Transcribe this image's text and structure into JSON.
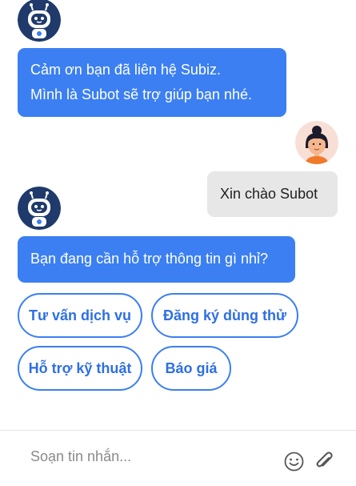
{
  "messages": {
    "bot_greeting_line1": "Cảm ơn bạn đã liên hệ Subiz.",
    "bot_greeting_line2": "Mình là Subot sẽ trợ giúp bạn nhé.",
    "user_message": "Xin chào Subot",
    "bot_question": "Bạn đang cần hỗ trợ thông tin gì nhỉ?"
  },
  "quick_replies": [
    "Tư vấn dịch vụ",
    "Đăng ký dùng thử",
    "Hỗ trợ kỹ thuật",
    "Báo giá"
  ],
  "composer": {
    "placeholder": "Soạn tin nhắn...",
    "emoji_icon": "smiley-icon",
    "attach_icon": "paperclip-icon"
  },
  "colors": {
    "accent": "#3b7ff2",
    "bot_avatar_bg": "#1f3a6b",
    "user_bubble": "#e7e7e7"
  }
}
